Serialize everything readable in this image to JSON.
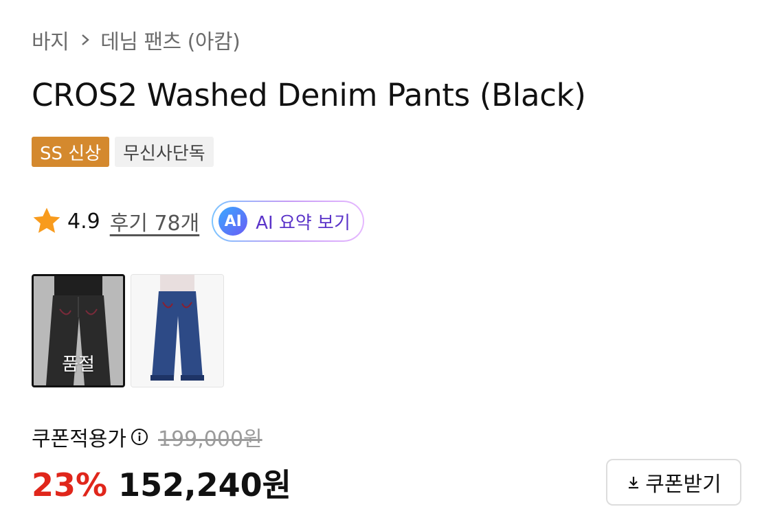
{
  "breadcrumb": {
    "category": "바지",
    "subcategory": "데님 팬츠 (아캄)",
    "separator_icon": "chevron-right-icon"
  },
  "product": {
    "title": "CROS2 Washed Denim Pants (Black)"
  },
  "badges": [
    {
      "label": "SS 신상",
      "color": "#d4892e"
    },
    {
      "label": "무신사단독",
      "color": "#f1f1f1"
    }
  ],
  "rating": {
    "score": "4.9",
    "reviews_label": "후기 78개",
    "star_icon": "star-icon",
    "star_color": "#f89b1d"
  },
  "ai_summary": {
    "mark": "AI",
    "label": "AI 요약 보기"
  },
  "thumbnails": [
    {
      "name": "black-pants",
      "status": "품절",
      "selected": true
    },
    {
      "name": "blue-pants",
      "status": "",
      "selected": false
    }
  ],
  "pricing": {
    "coupon_label": "쿠폰적용가",
    "original_price": "199,000원",
    "discount": "23%",
    "final_price": "152,240원",
    "discount_color": "#e0261b"
  },
  "coupon_button": {
    "label": "쿠폰받기",
    "icon": "download-icon"
  }
}
